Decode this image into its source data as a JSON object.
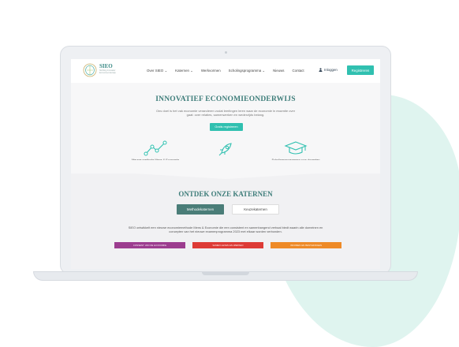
{
  "header": {
    "brand": "SIEO",
    "brand_sub": "Stichting Innovatief Economieonderwijs",
    "nav": [
      "Over SIEO ⌄",
      "Katernen ⌄",
      "Werkvormen",
      "Scholingsprogramma ⌄",
      "Nieuws",
      "Contact"
    ],
    "login_label": "Inloggen",
    "register_label": "Registreren",
    "colors": {
      "accent": "#30c0b0",
      "brand": "#3e7d7a"
    }
  },
  "hero": {
    "title": "INNOVATIEF ECONOMIEONDERWIJS",
    "text": "Ons doel is het vak economie veranderen zodat leerlingen leren waar de economie in essentie over gaat: over relaties, samenwerken en wederzijds belang.",
    "cta_label": "Gratis registreren",
    "features": [
      {
        "icon": "network-icon",
        "label": "Nieuwe methode Mens & Economie"
      },
      {
        "icon": "rocket-icon",
        "label": "Innovatieve werkvormen"
      },
      {
        "icon": "graduation-cap-icon",
        "label": "Scholingsprogramma voor docenten"
      }
    ]
  },
  "katernen": {
    "title": "ONTDEK ONZE KATERNEN",
    "tabs": [
      "Methodekaternen",
      "Keuzekaternen"
    ],
    "description": "SIEO ontwikkelt een nieuwe economiemethode Mens & Economie die een consistent en samenhangend verhaal biedt waarin alle domeinen en concepten van het nieuwe examenprogramma 2023 met elkaar worden verbonden.",
    "bars": [
      "CONSENT VAN DE ECONOMIE",
      "SAMEN LEVEN EN WERKEN",
      "INKOMEN EN BESTEDINGEN"
    ],
    "bar_colors": [
      "#9c3d8f",
      "#dd3b36",
      "#ee8a27"
    ]
  }
}
